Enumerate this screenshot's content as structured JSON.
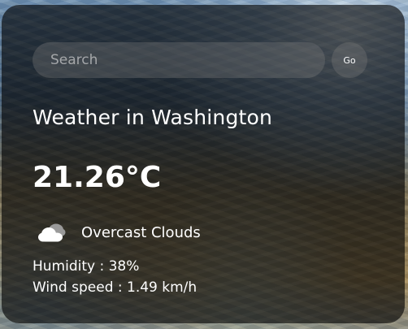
{
  "search": {
    "placeholder": "Search",
    "value": "",
    "go_label": "Go"
  },
  "weather": {
    "title": "Weather in Washington",
    "temperature": "21.26°C",
    "condition": "Overcast Clouds",
    "condition_icon": "overcast-cloud-icon",
    "humidity": "Humidity : 38%",
    "wind": "Wind speed : 1.49 km/h"
  }
}
